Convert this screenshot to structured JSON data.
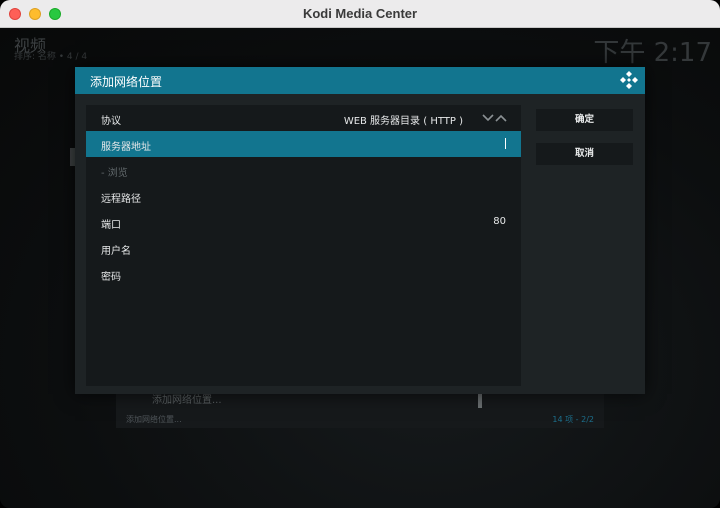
{
  "window": {
    "title": "Kodi Media Center"
  },
  "background": {
    "section_title": "视频",
    "sort_info": "排序: 名称  •  4 / 4",
    "clock": "下午 2:17",
    "list_item": "添加网络位置...",
    "footer_left": "添加网络位置...",
    "footer_right": "14 项 - 2/2"
  },
  "dialog": {
    "title": "添加网络位置",
    "rows": [
      {
        "label": "协议",
        "value": "WEB 服务器目录 ( HTTP )"
      },
      {
        "label": "服务器地址",
        "value": ""
      },
      {
        "label": "- 浏览",
        "value": ""
      },
      {
        "label": "远程路径",
        "value": ""
      },
      {
        "label": "端口",
        "value": "80"
      },
      {
        "label": "用户名",
        "value": ""
      },
      {
        "label": "密码",
        "value": ""
      }
    ],
    "ok_label": "确定",
    "cancel_label": "取消"
  },
  "colors": {
    "accent": "#12758f",
    "dialog_bg": "#1e2325",
    "list_bg": "#15191b"
  },
  "icons": {
    "kodi_logo": "kodi-logo-icon",
    "spinner": "up-down-spinner-icon"
  }
}
